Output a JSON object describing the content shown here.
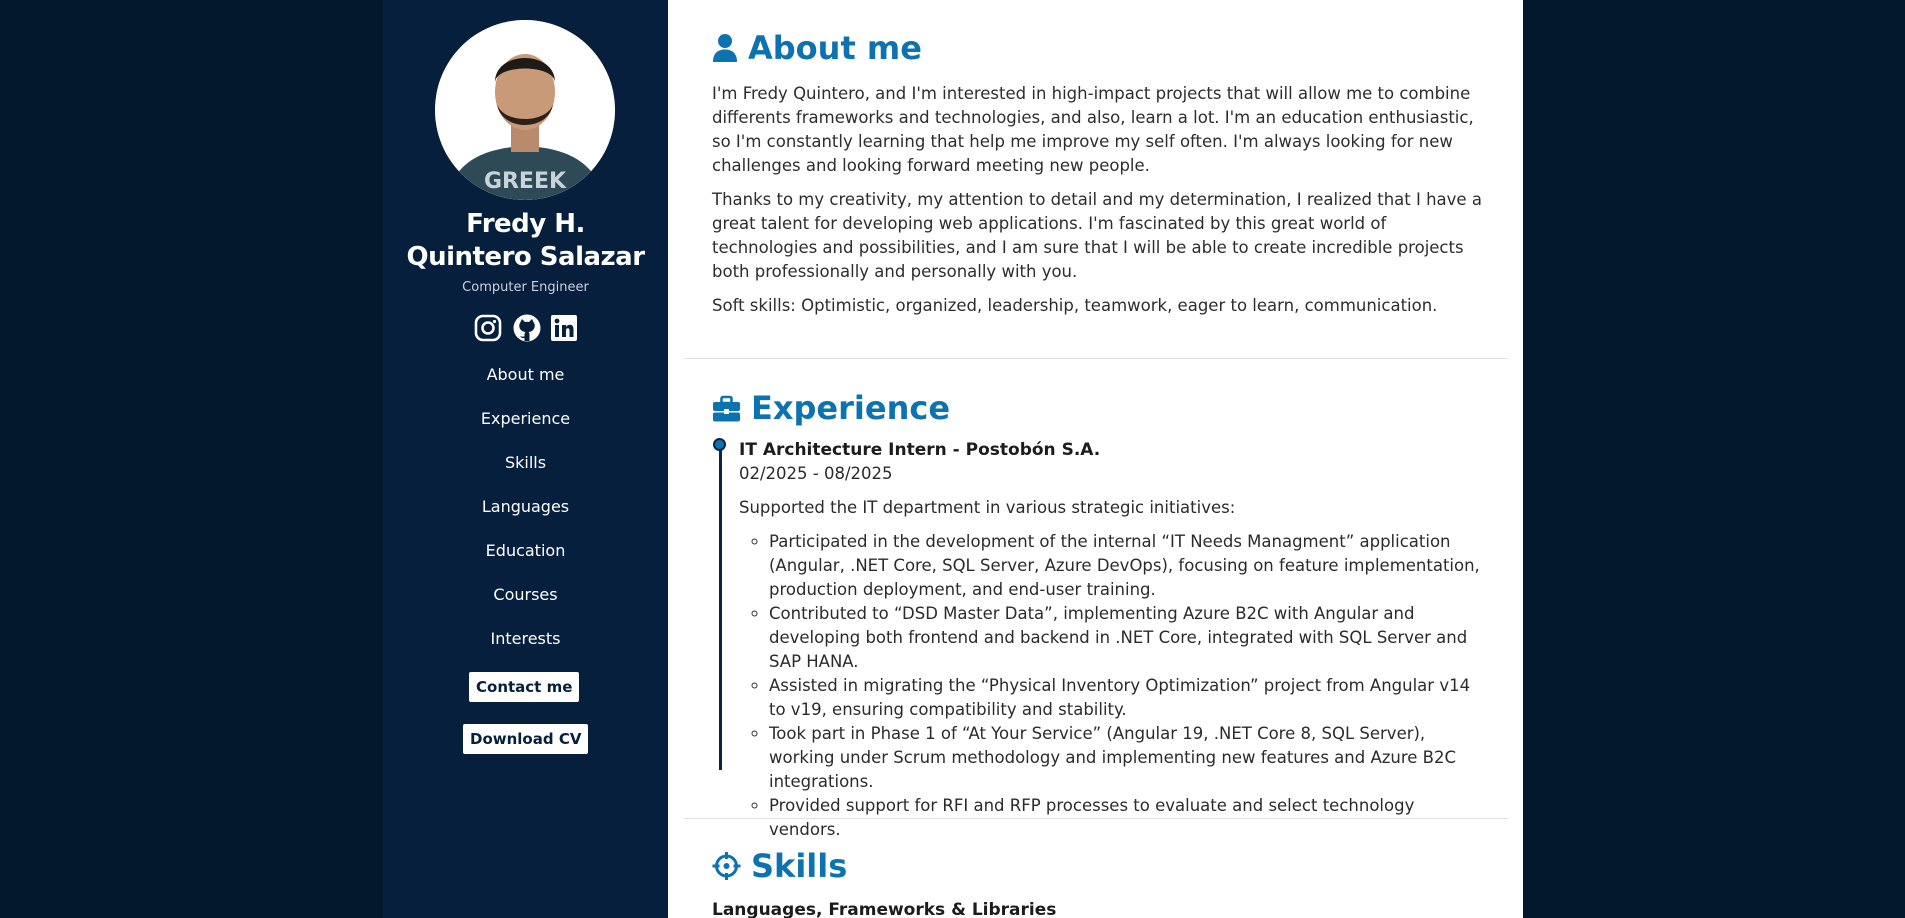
{
  "sidebar": {
    "name_line1": "Fredy H.",
    "name_line2": "Quintero Salazar",
    "role": "Computer Engineer",
    "social": [
      "instagram-icon",
      "github-icon",
      "linkedin-icon"
    ],
    "nav": [
      "About me",
      "Experience",
      "Skills",
      "Languages",
      "Education",
      "Courses",
      "Interests"
    ],
    "contact_label": "Contact me",
    "cv_label": "Download CV"
  },
  "colors": {
    "background": "#04182d",
    "sidebar": "#061f3d",
    "accent": "#0d73b0",
    "content": "#ffffff"
  },
  "about": {
    "title": "About me",
    "p1": "I'm Fredy Quintero, and I'm interested in high-impact projects that will allow me to combine differents frameworks and technologies, and also, learn a lot. I'm an education enthusiastic, so I'm constantly learning that help me improve my self often. I'm always looking for new challenges and looking forward meeting new people.",
    "p2": "Thanks to my creativity, my attention to detail and my determination, I realized that I have a great talent for developing web applications. I'm fascinated by this great world of technologies and possibilities, and I am sure that I will be able to create incredible projects both professionally and personally with you.",
    "p3": "Soft skills: Optimistic, organized, leadership, teamwork, eager to learn, communication."
  },
  "experience": {
    "title": "Experience",
    "job_title": "IT Architecture Intern - Postobón S.A.",
    "dates": "02/2025 - 08/2025",
    "summary": "Supported the IT department in various strategic initiatives:",
    "bullets": [
      "Participated in the development of the internal “IT Needs Managment” application (Angular, .NET Core, SQL Server, Azure DevOps), focusing on feature implementation, production deployment, and end-user training.",
      "Contributed to “DSD Master Data”, implementing Azure B2C with Angular and developing both frontend and backend in .NET Core, integrated with SQL Server and SAP HANA.",
      "Assisted in migrating the “Physical Inventory Optimization” project from Angular v14 to v19, ensuring compatibility and stability.",
      "Took part in Phase 1 of “At Your Service” (Angular 19, .NET Core 8, SQL Server), working under Scrum methodology and implementing new features and Azure B2C integrations.",
      "Provided support for RFI and RFP processes to evaluate and select technology vendors."
    ]
  },
  "skills": {
    "title": "Skills",
    "subhead": "Languages, Frameworks & Libraries"
  }
}
